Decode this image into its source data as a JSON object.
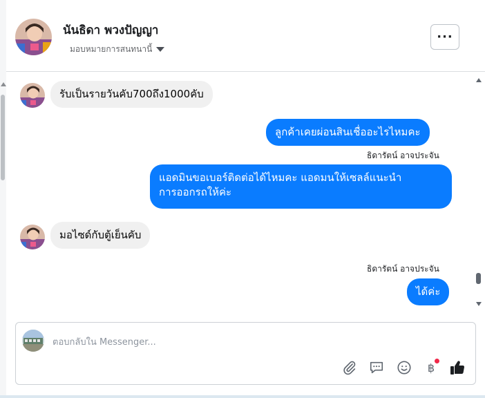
{
  "header": {
    "name": "นันธิดา พวงปัญญา",
    "assign_label": "มอบหมายการสนทนานี้",
    "more_label": "···"
  },
  "messages": [
    {
      "direction": "in",
      "text": "รับเป็นรายวันคับ700ถึง1000คับ"
    },
    {
      "direction": "out",
      "text": "ลูกค้าเคยผ่อนสินเชื่ออะไรไหมคะ"
    },
    {
      "direction": "sender",
      "text": "ธิดารัตน์ อาจประจัน"
    },
    {
      "direction": "out",
      "text_line1": "แอดมินขอเบอร์ติดต่อได้ไหมคะ แอดมนให้เซลล์แนะนำ",
      "text_line2": "การออกรถให้ค่ะ"
    },
    {
      "direction": "in",
      "text": "มอไซด์กับตู้เย็นคับ"
    },
    {
      "direction": "sender",
      "text": "ธิดารัตน์ อาจประจัน"
    },
    {
      "direction": "out",
      "text": "ได้ค่ะ"
    }
  ],
  "composer": {
    "placeholder": "ตอบกลับใน Messenger...",
    "baht_symbol": "฿"
  },
  "colors": {
    "outgoing_bubble": "#0a7cff",
    "incoming_bubble": "#f0f0f0",
    "like_icon": "#1c1e21",
    "notification_dot": "#f02849"
  },
  "icons": [
    "more-icon",
    "caret-down-icon",
    "attachment-icon",
    "sticker-icon",
    "emoji-icon",
    "baht-icon",
    "like-icon"
  ]
}
